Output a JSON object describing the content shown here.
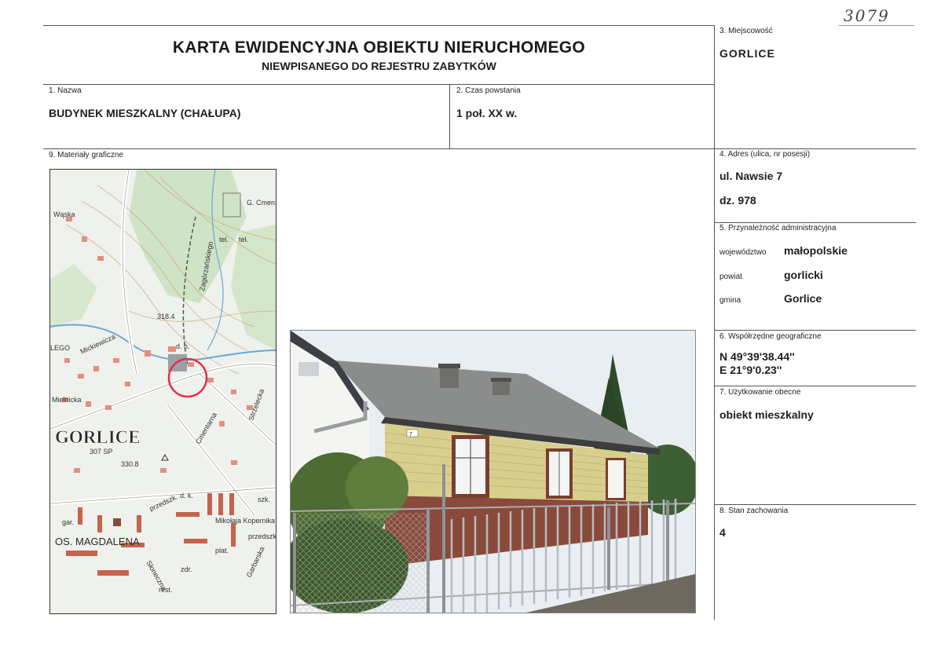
{
  "handwritten_number": "3079",
  "header": {
    "title": "KARTA EWIDENCYJNA OBIEKTU NIERUCHOMEGO",
    "subtitle": "NIEWPISANEGO DO REJESTRU ZABYTKÓW"
  },
  "fields": {
    "miejscowosc": {
      "label": "3. Miejscowość",
      "value": "GORLICE"
    },
    "nazwa": {
      "label": "1. Nazwa",
      "value": "BUDYNEK MIESZKALNY (CHAŁUPA)"
    },
    "czas": {
      "label": "2. Czas powstania",
      "value": "1 poł. XX w."
    },
    "materialy": {
      "label": "9. Materiały graficzne"
    },
    "adres": {
      "label": "4. Adres (ulica, nr posesji)",
      "street": "ul. Nawsie 7",
      "plot": "dz. 978"
    },
    "admin": {
      "label": "5. Przynależność administracyjna",
      "wojewodztwo_label": "województwo",
      "wojewodztwo": "małopolskie",
      "powiat_label": "powiat",
      "powiat": "gorlicki",
      "gmina_label": "gmina",
      "gmina": "Gorlice"
    },
    "wspolrzedne": {
      "label": "6. Współrzędne geograficzne",
      "n": "N 49°39'38.44''",
      "e": "E 21°9'0.23''"
    },
    "uzytkowanie": {
      "label": "7. Użytkowanie obecne",
      "value": "obiekt mieszkalny"
    },
    "stan": {
      "label": "8. Stan zachowania",
      "value": "4"
    }
  },
  "map": {
    "town": "GORLICE",
    "district": "OS. MAGDALENA",
    "labels": [
      "Wąska",
      "G. Cmen.",
      "tel.",
      "tel.",
      "318.4",
      "LEGO",
      "d. h.",
      "Mickiewicza",
      "Strzelecka",
      "Mielnicka",
      "Cmentarna",
      "307 SP",
      "330.8",
      "d. k.",
      "szk.",
      "przedszk.",
      "gar.",
      "Mikołaja Kopernika",
      "przedszk.",
      "zdr.",
      "Słoneczna",
      "rest.",
      "Zagórzańskiego",
      "Garbarska",
      "plat."
    ]
  },
  "photo": {
    "house_number": "7"
  }
}
